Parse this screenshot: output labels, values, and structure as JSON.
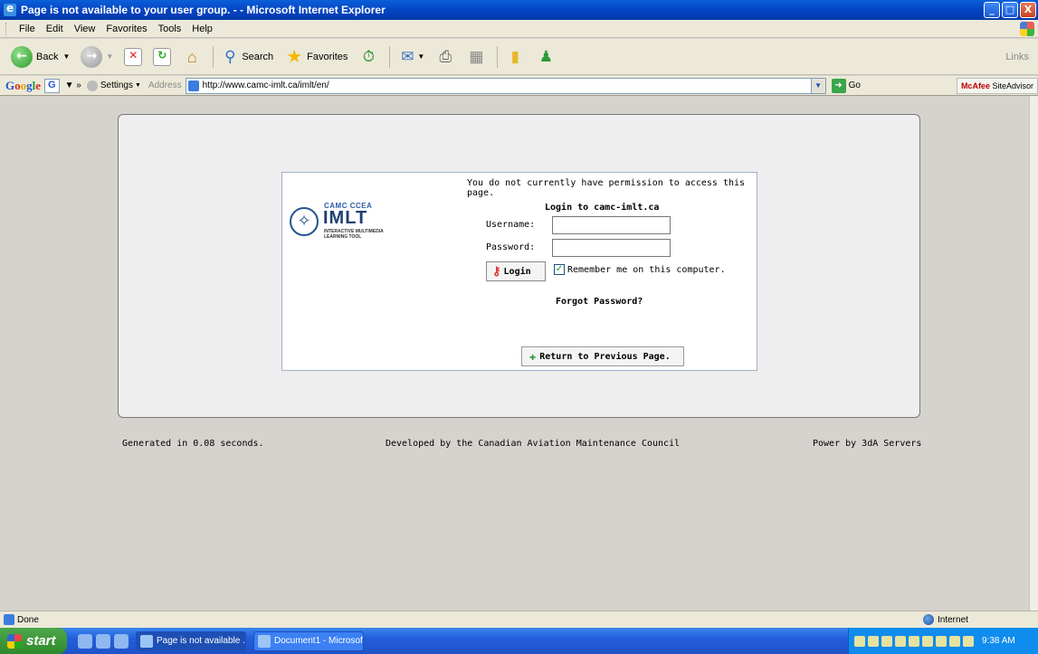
{
  "window": {
    "title": "Page is not available to your user group. - - Microsoft Internet Explorer",
    "min": "_",
    "max": "□",
    "close": "X"
  },
  "menu": [
    "File",
    "Edit",
    "View",
    "Favorites",
    "Tools",
    "Help"
  ],
  "toolbar": {
    "back": "Back",
    "search": "Search",
    "favorites": "Favorites",
    "links": "Links"
  },
  "addressbar": {
    "google_button": "G",
    "settings": "Settings",
    "address_label": "Address",
    "url": "http://www.camc-imlt.ca/imlt/en/",
    "go": "Go",
    "mcafee_brand": "McAfee",
    "mcafee_product": "SiteAdvisor"
  },
  "page": {
    "permission_message": "You do not currently have permission to access this page.",
    "logo": {
      "org": "CAMC CCEA",
      "brand": "IMLT",
      "tagline": "INTERACTIVE MULTIMEDIA LEARNING TOOL"
    },
    "login_title": "Login to camc-imlt.ca",
    "username_label": "Username:",
    "password_label": "Password:",
    "login_button": "Login",
    "remember_label": "Remember me on this computer.",
    "remember_checked": true,
    "forgot_password": "Forgot Password?",
    "return_button": "Return to Previous Page.",
    "footer": {
      "generated": "Generated in 0.08 seconds.",
      "developed": "Developed by the Canadian Aviation Maintenance Council",
      "power": "Power by 3dA Servers"
    }
  },
  "statusbar": {
    "status": "Done",
    "zone": "Internet"
  },
  "taskbar": {
    "start": "start",
    "tasks": [
      "Page is not available ...",
      "Document1 - Microsof..."
    ],
    "clock": "9:38 AM"
  }
}
